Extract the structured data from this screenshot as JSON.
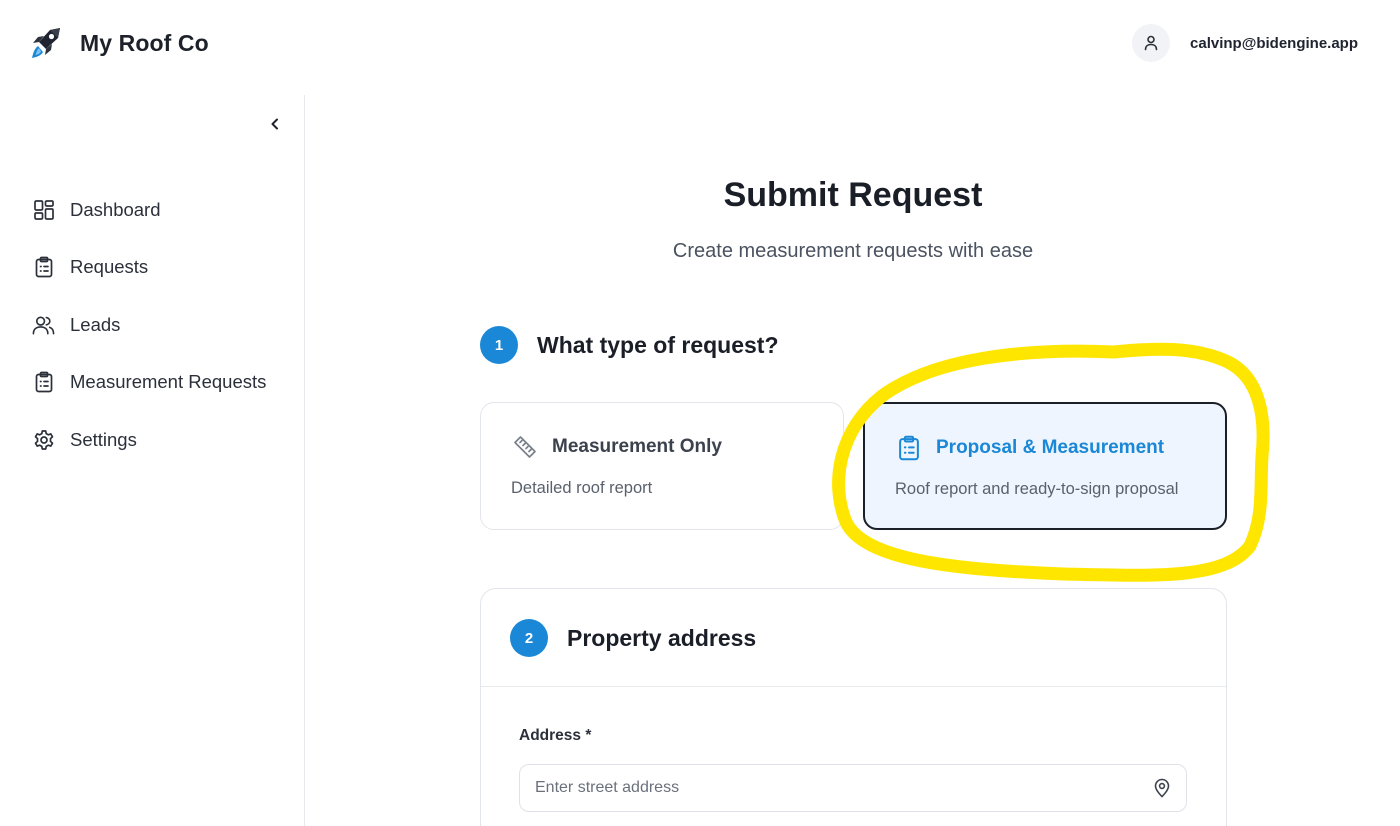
{
  "header": {
    "brand_name": "My Roof Co",
    "logo_icon": "rocket-icon",
    "user_email": "calvinp@bidengine.app",
    "avatar_icon": "user-icon"
  },
  "sidebar": {
    "collapse_icon": "chevron-left-icon",
    "items": [
      {
        "label": "Dashboard",
        "icon": "dashboard-icon"
      },
      {
        "label": "Requests",
        "icon": "clipboard-list-icon"
      },
      {
        "label": "Leads",
        "icon": "users-icon"
      },
      {
        "label": "Measurement Requests",
        "icon": "clipboard-list-icon"
      },
      {
        "label": "Settings",
        "icon": "gear-icon"
      }
    ]
  },
  "main": {
    "title": "Submit Request",
    "subtitle": "Create measurement requests with ease",
    "step1": {
      "number": "1",
      "title": "What type of request?",
      "options": [
        {
          "title": "Measurement Only",
          "description": "Detailed roof report",
          "icon": "ruler-icon",
          "selected": false
        },
        {
          "title": "Proposal & Measurement",
          "description": "Roof report and ready-to-sign proposal",
          "icon": "clipboard-list-icon",
          "selected": true
        }
      ]
    },
    "step2": {
      "number": "2",
      "title": "Property address",
      "address_label": "Address *",
      "address_placeholder": "Enter street address",
      "address_value": "",
      "pin_icon": "map-pin-icon"
    }
  },
  "colors": {
    "accent": "#1a88d6",
    "selected_card_bg": "#eef5fe",
    "highlight_annotation": "#ffe600"
  }
}
